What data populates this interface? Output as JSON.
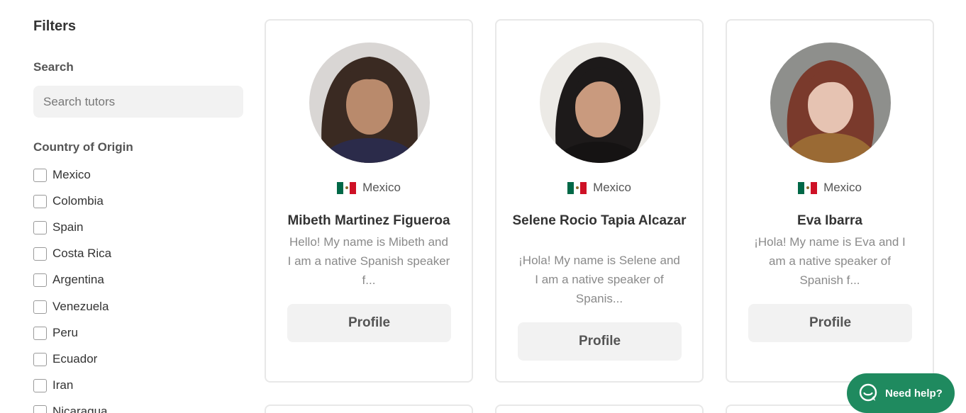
{
  "filters": {
    "title": "Filters",
    "search_label": "Search",
    "search_placeholder": "Search tutors",
    "search_value": "",
    "country_label": "Country of Origin",
    "countries": [
      {
        "label": "Mexico",
        "checked": false
      },
      {
        "label": "Colombia",
        "checked": false
      },
      {
        "label": "Spain",
        "checked": false
      },
      {
        "label": "Costa Rica",
        "checked": false
      },
      {
        "label": "Argentina",
        "checked": false
      },
      {
        "label": "Venezuela",
        "checked": false
      },
      {
        "label": "Peru",
        "checked": false
      },
      {
        "label": "Ecuador",
        "checked": false
      },
      {
        "label": "Iran",
        "checked": false
      },
      {
        "label": "Nicaragua",
        "checked": false
      }
    ]
  },
  "tutors": [
    {
      "country": "Mexico",
      "name": "Mibeth Martinez Figueroa",
      "bio": "Hello! My name is Mibeth and I am a native Spanish speaker f...",
      "button_label": "Profile"
    },
    {
      "country": "Mexico",
      "name": "Selene Rocio Tapia Alcazar",
      "bio": "¡Hola! My name is Selene and I am a native speaker of Spanis...",
      "button_label": "Profile"
    },
    {
      "country": "Mexico",
      "name": "Eva Ibarra",
      "bio": "¡Hola! My name is Eva and I am a native speaker of Spanish f...",
      "button_label": "Profile"
    }
  ],
  "help": {
    "label": "Need help?",
    "icon": "chat-bubble-icon"
  },
  "colors": {
    "accent": "#1f8a5f",
    "button_bg": "#f2f2f2",
    "flag_green": "#006847",
    "flag_red": "#ce1126"
  }
}
